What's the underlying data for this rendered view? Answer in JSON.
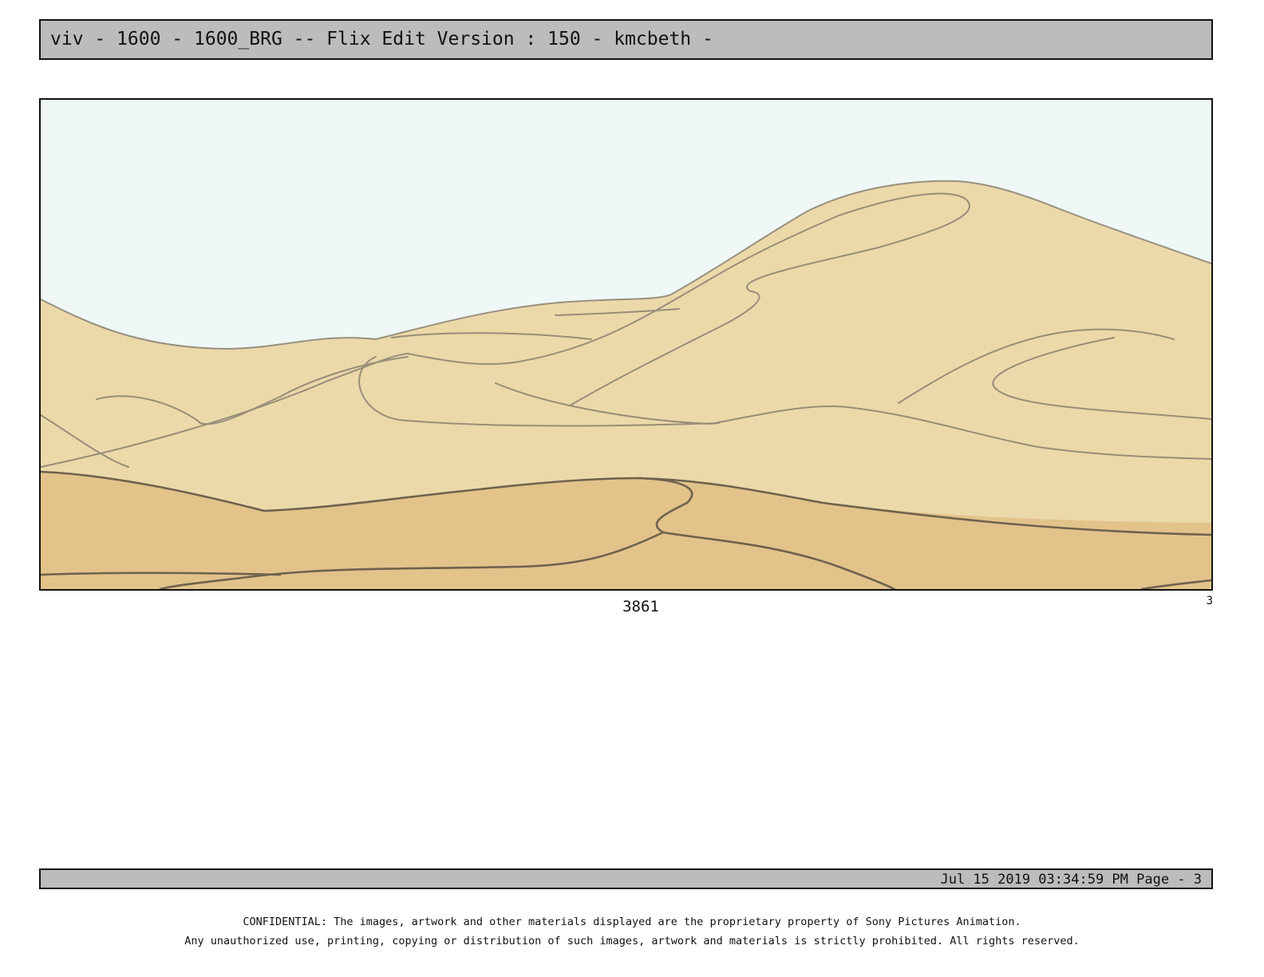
{
  "header": {
    "title": "viv - 1600 - 1600_BRG -- Flix Edit Version : 150 - kmcbeth -"
  },
  "panel": {
    "number": "3861",
    "page_marker": "3",
    "colors": {
      "sky": "#eff7f7",
      "far_dune": "#ebd9aa",
      "near_dune": "#e2c38a",
      "line": "#6e624d"
    }
  },
  "footer": {
    "timestamp": "Jul 15 2019 03:34:59 PM Page - 3"
  },
  "confidential": {
    "line1": "CONFIDENTIAL: The images, artwork and other materials displayed are the proprietary property of Sony Pictures Animation.",
    "line2": "Any unauthorized use, printing, copying or distribution of such images, artwork and materials is strictly prohibited. All rights reserved."
  }
}
